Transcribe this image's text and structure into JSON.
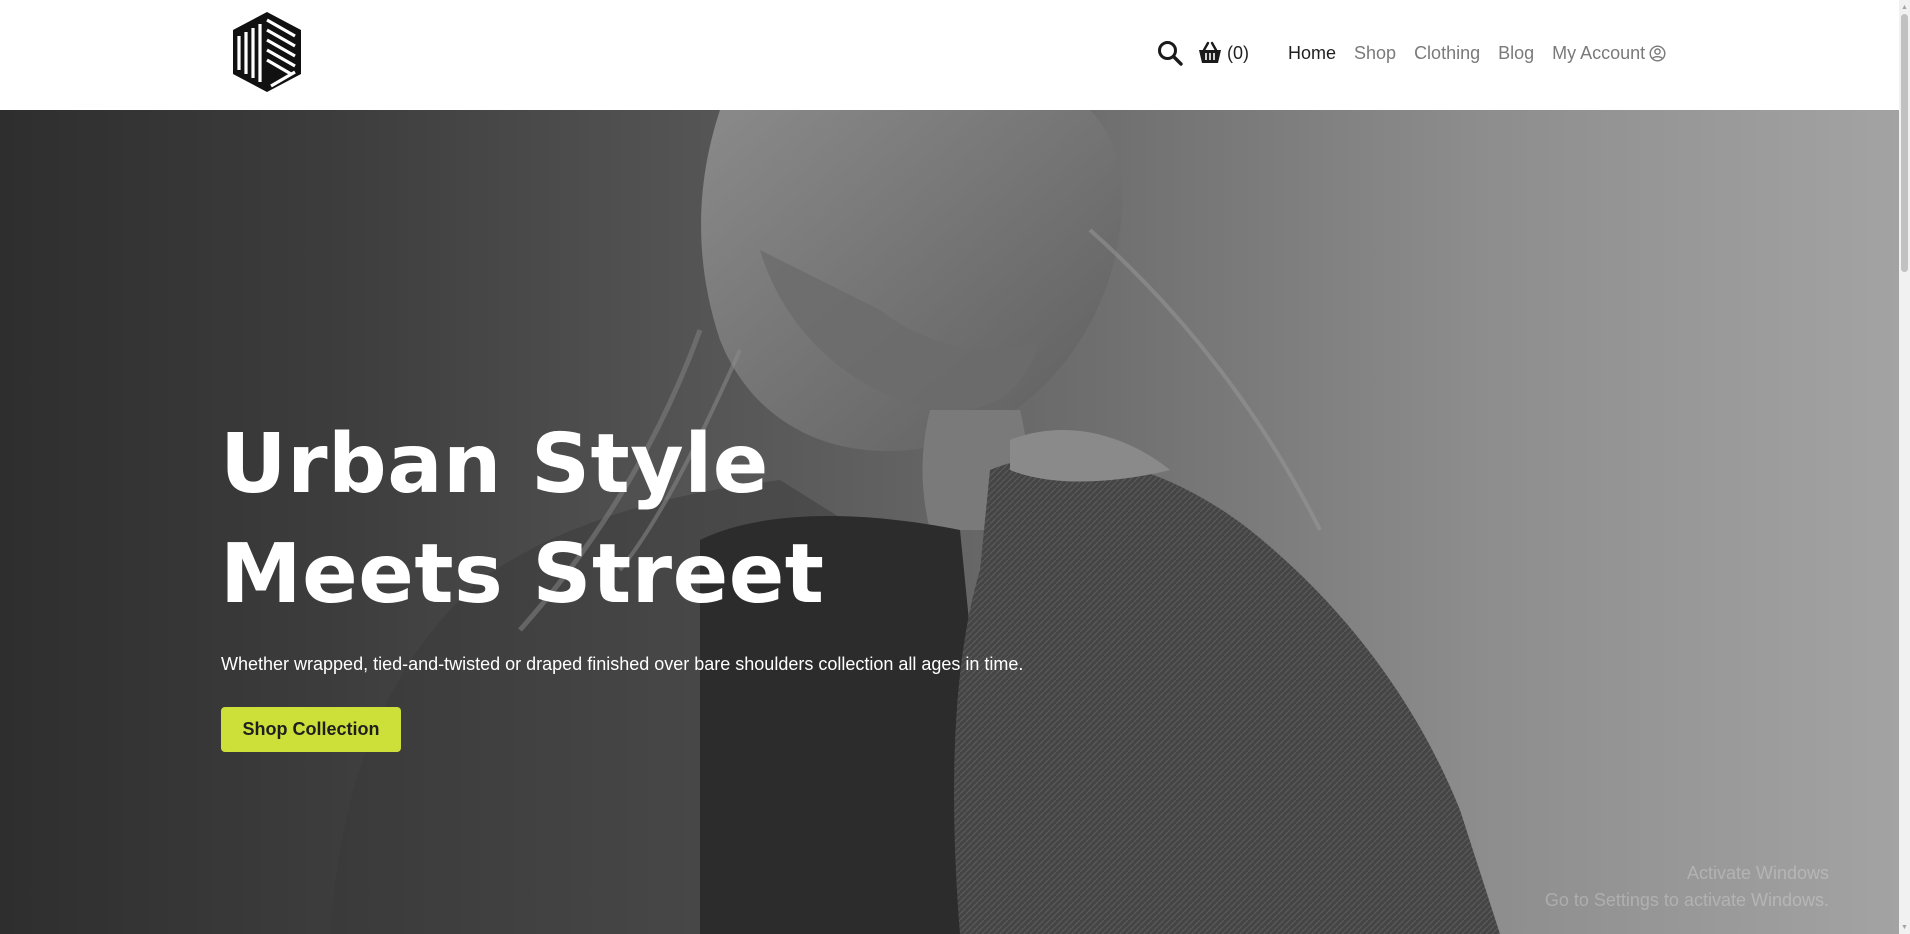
{
  "colors": {
    "accent": "#cde03a",
    "nav_active": "#1f1f1f",
    "nav_inactive": "#7a7a7a",
    "header_bg": "#ffffff"
  },
  "header": {
    "logo_icon": "brand-cube-logo",
    "search_icon": "search-icon",
    "cart_icon": "basket-icon",
    "cart_count": "(0)",
    "nav": {
      "home": "Home",
      "shop": "Shop",
      "clothing": "Clothing",
      "blog": "Blog",
      "account": "My Account",
      "account_icon": "user-circle-icon"
    }
  },
  "hero": {
    "title_line1": "Urban Style",
    "title_line2": "Meets Street",
    "subtitle": "Whether wrapped, tied-and-twisted or draped finished over bare shoulders collection all ages in time.",
    "cta_label": "Shop Collection",
    "watermark_line1": "Activate Windows",
    "watermark_line2": "Go to Settings to activate Windows."
  }
}
